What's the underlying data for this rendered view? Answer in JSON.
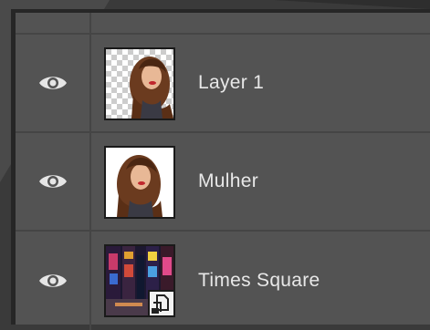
{
  "layers_panel": {
    "layers": [
      {
        "name": "Layer 1",
        "visible": true,
        "thumbnail": "portrait-on-transparent",
        "visibility_icon": "eye-icon"
      },
      {
        "name": "Mulher",
        "visible": true,
        "thumbnail": "portrait-on-white",
        "visibility_icon": "eye-icon"
      },
      {
        "name": "Times Square",
        "visible": true,
        "thumbnail": "city-night-photo",
        "visibility_icon": "eye-icon",
        "badge_icon": "smart-object-icon"
      }
    ]
  },
  "colors": {
    "panel_bg": "#535353",
    "divider": "#454545",
    "frame_dark": "#262626",
    "text": "#e8e8e8",
    "eye": "#e6e6e6"
  }
}
